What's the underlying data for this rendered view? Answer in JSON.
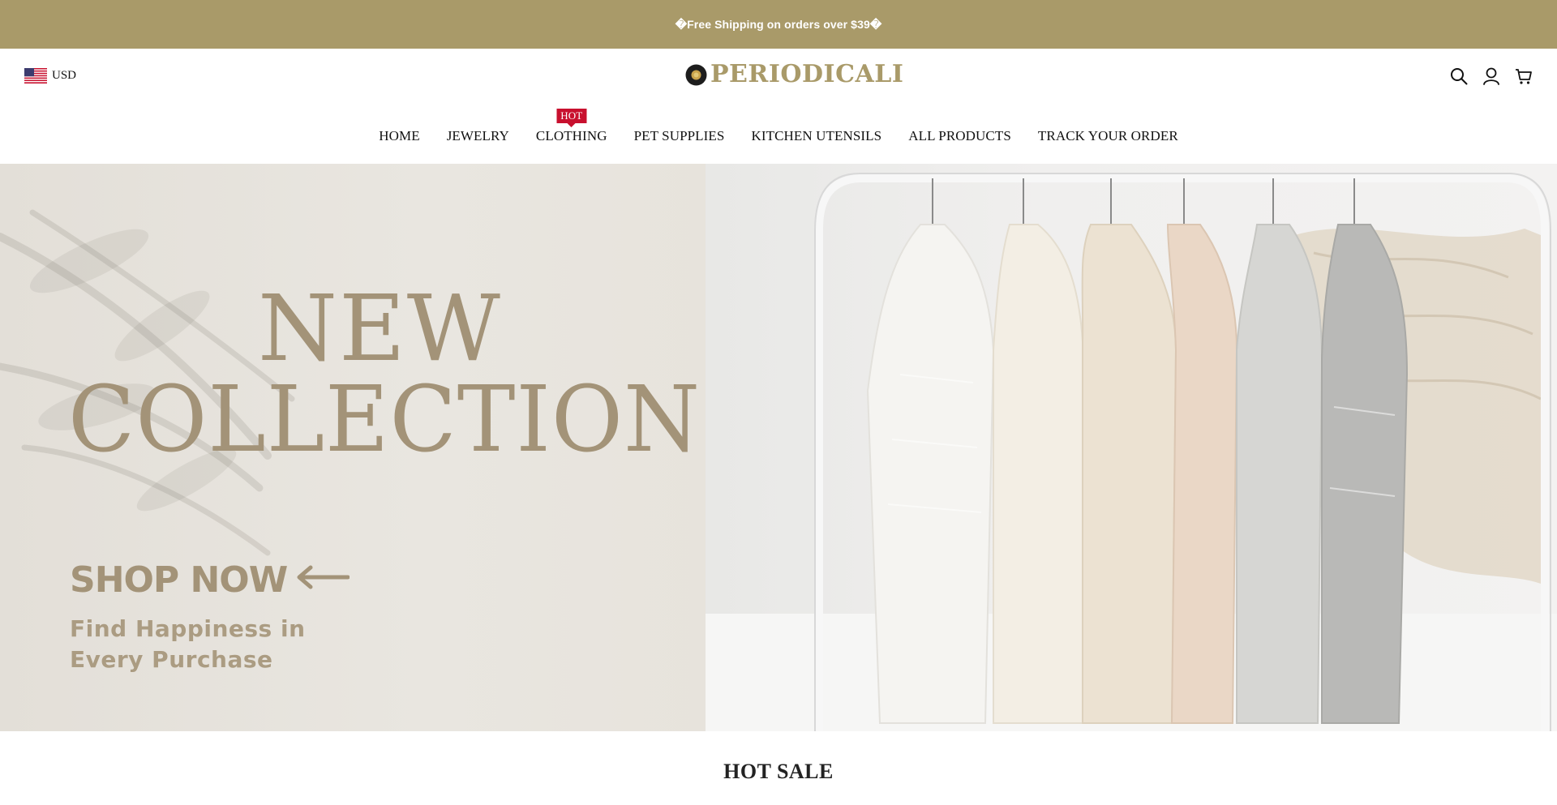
{
  "announcement": {
    "text": "�Free Shipping on orders over $39�"
  },
  "header": {
    "currency": "USD",
    "logo_text": "PERIODICALI"
  },
  "nav": {
    "items": [
      {
        "label": "HOME"
      },
      {
        "label": "JEWELRY"
      },
      {
        "label": "CLOTHING",
        "badge": "HOT"
      },
      {
        "label": "PET SUPPLIES"
      },
      {
        "label": "KITCHEN UTENSILS"
      },
      {
        "label": "ALL PRODUCTS"
      },
      {
        "label": "TRACK YOUR ORDER"
      }
    ]
  },
  "hero": {
    "headline_line1": "NEW",
    "headline_line2": "COLLECTION",
    "cta": "SHOP NOW",
    "tagline_line1": "Find Happiness in",
    "tagline_line2": "Every Purchase"
  },
  "section": {
    "title": "HOT SALE"
  },
  "colors": {
    "accent": "#a99a69",
    "hot_badge": "#c8102e",
    "hero_text": "#a39378"
  },
  "icons": [
    "us-flag-icon",
    "search-icon",
    "account-icon",
    "cart-icon",
    "arrow-left-icon"
  ]
}
